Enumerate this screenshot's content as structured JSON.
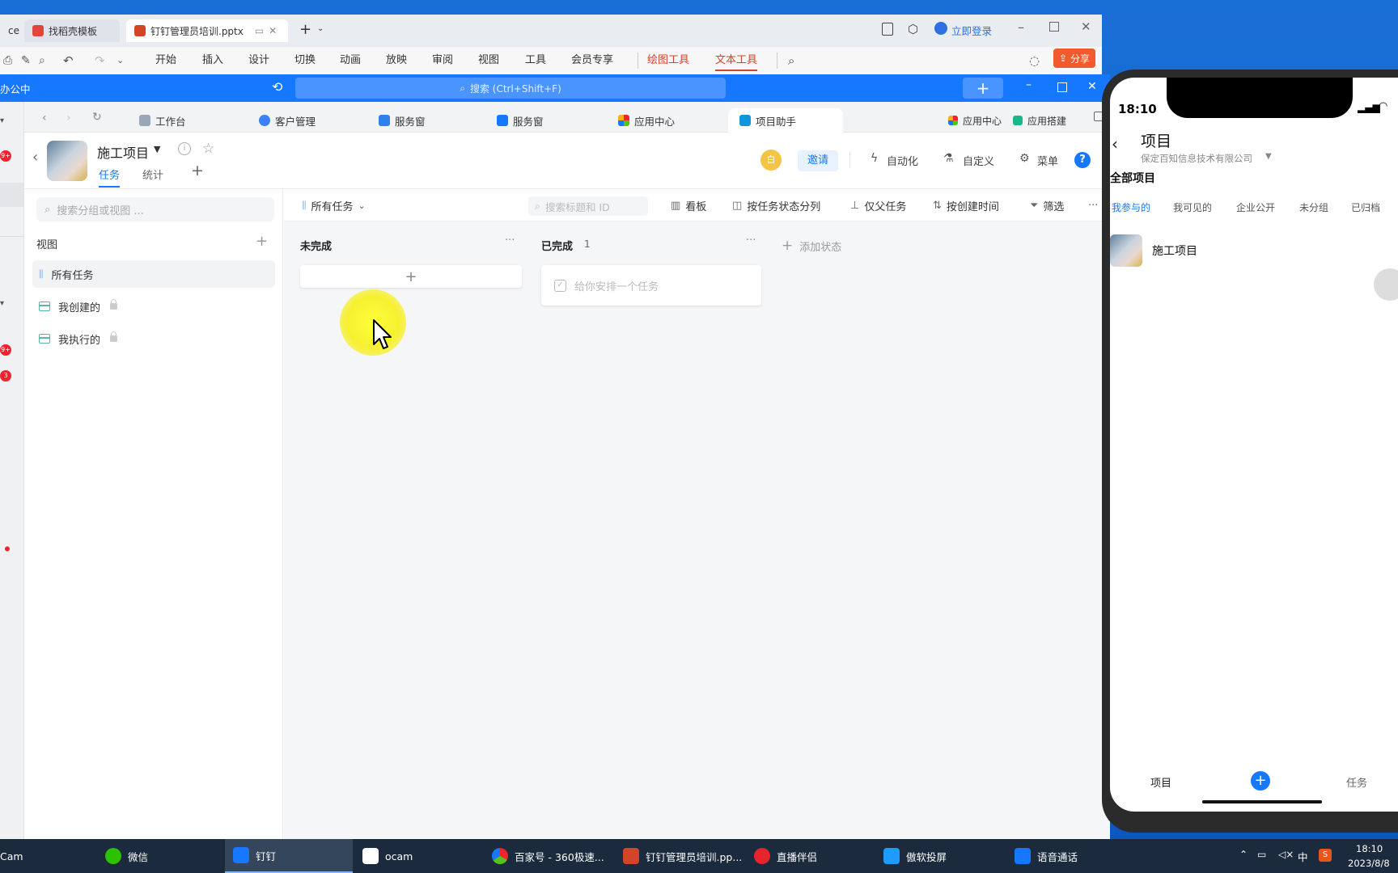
{
  "wps": {
    "tabs": [
      {
        "label": "ce"
      },
      {
        "label": "找稻壳模板"
      },
      {
        "label": "钉钉管理员培训.pptx"
      }
    ],
    "login": "立即登录",
    "ribbon": [
      "开始",
      "插入",
      "设计",
      "切换",
      "动画",
      "放映",
      "审阅",
      "视图",
      "工具",
      "会员专享",
      "绘图工具",
      "文本工具"
    ],
    "share": "分享"
  },
  "dingtalk": {
    "app_label": "办公中",
    "search_placeholder": "搜索 (Ctrl+Shift+F)",
    "tabs": [
      "工作台",
      "客户管理",
      "服务窗",
      "服务窗",
      "应用中心",
      "项目助手"
    ],
    "tab_right": [
      "应用中心",
      "应用搭建"
    ],
    "project": {
      "name": "施工项目",
      "subtabs": [
        "任务",
        "统计"
      ],
      "user_initial": "白",
      "invite": "邀请",
      "actions": [
        "自动化",
        "自定义",
        "菜单"
      ]
    },
    "sidebar": {
      "search_placeholder": "搜索分组或视图 ...",
      "section": "视图",
      "items": [
        {
          "label": "所有任务"
        },
        {
          "label": "我创建的"
        },
        {
          "label": "我执行的"
        }
      ]
    },
    "toolbar": {
      "view": "所有任务",
      "search_placeholder": "搜索标题和 ID",
      "board": "看板",
      "group": "按任务状态分列",
      "parent": "仅父任务",
      "sort": "按创建时间",
      "filter": "筛选"
    },
    "board": {
      "col1": {
        "title": "未完成"
      },
      "col2": {
        "title": "已完成",
        "count": "1",
        "card": "给你安排一个任务"
      },
      "add_status": "添加状态"
    },
    "left_badges": [
      "9+",
      "9+",
      "3"
    ]
  },
  "phone": {
    "time": "18:10",
    "title": "项目",
    "company": "保定百知信息技术有限公司",
    "section": "全部项目",
    "filters": [
      "我参与的",
      "我可见的",
      "企业公开",
      "未分组",
      "已归档"
    ],
    "project": "施工项目",
    "bottom": {
      "left": "项目",
      "right": "任务"
    }
  },
  "taskbar": {
    "items": [
      "Cam",
      "微信",
      "钉钉",
      "ocam",
      "百家号 - 360极速...",
      "钉钉管理员培训.pp...",
      "直播伴侣",
      "傲软投屏",
      "语音通话"
    ],
    "ime": "中",
    "time": "18:10",
    "date": "2023/8/8"
  },
  "colors": {
    "accent": "#1677ff",
    "wps_accent": "#d4442b",
    "taskbar": "#1b2a3d"
  }
}
